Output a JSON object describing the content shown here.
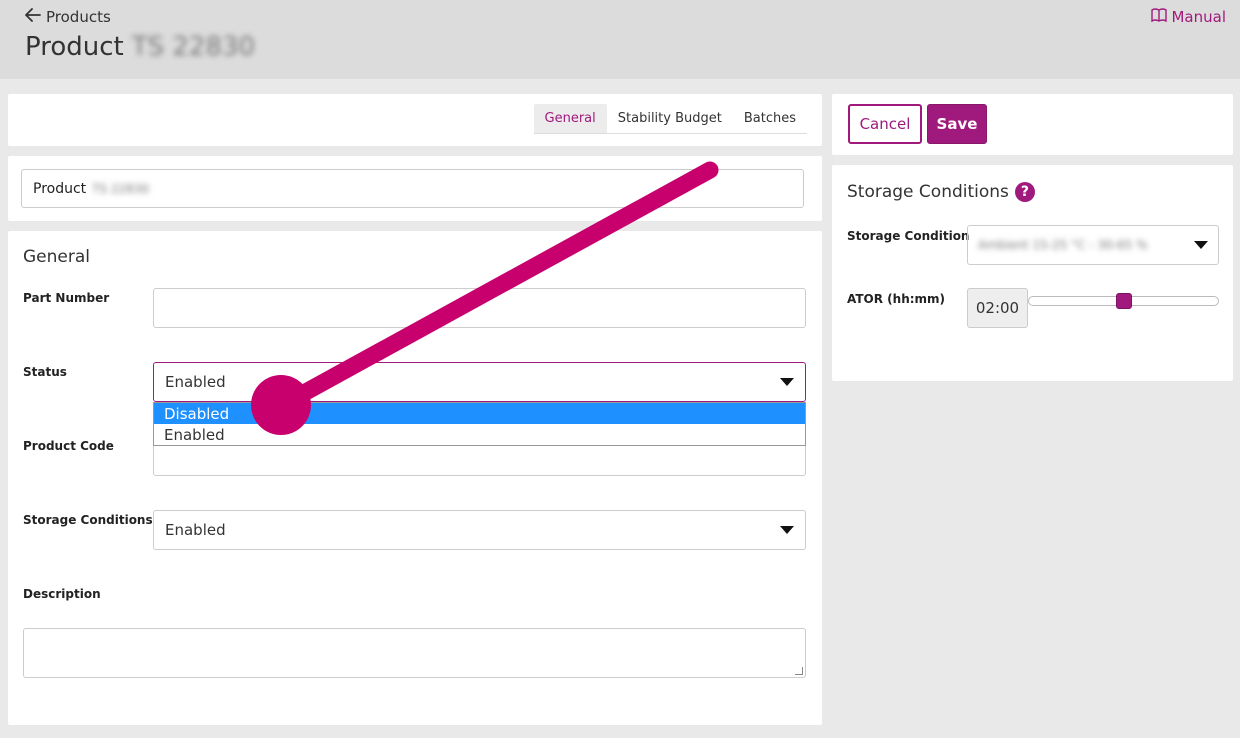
{
  "header": {
    "back_label": "Products",
    "title": "Product",
    "title_id": "TS 22830",
    "manual_label": "Manual"
  },
  "tabs": [
    {
      "label": "General",
      "active": true
    },
    {
      "label": "Stability Budget",
      "active": false
    },
    {
      "label": "Batches",
      "active": false
    }
  ],
  "product_name": {
    "prefix": "Product",
    "id": "TS 22830"
  },
  "general": {
    "section_title": "General",
    "part_number_label": "Part Number",
    "part_number_value": "",
    "status_label": "Status",
    "status_value": "Enabled",
    "status_options": [
      "Disabled",
      "Enabled"
    ],
    "status_highlighted": "Disabled",
    "product_code_label": "Product Code",
    "product_code_value": "",
    "storage_conditions_label": "Storage Conditions",
    "storage_conditions_value": "Enabled",
    "description_label": "Description",
    "description_value": ""
  },
  "actions": {
    "cancel_label": "Cancel",
    "save_label": "Save"
  },
  "storage": {
    "title": "Storage Conditions",
    "help_glyph": "?",
    "condition_label": "Storage Condition",
    "condition_value": "Ambient 15-25 °C - 30-65 %",
    "ator_label": "ATOR (hh:mm)",
    "ator_value": "02:00",
    "ator_slider_fraction": 0.5
  },
  "colors": {
    "accent": "#a01a7d",
    "pointer": "#c8006e",
    "option_highlight": "#1e90ff"
  }
}
